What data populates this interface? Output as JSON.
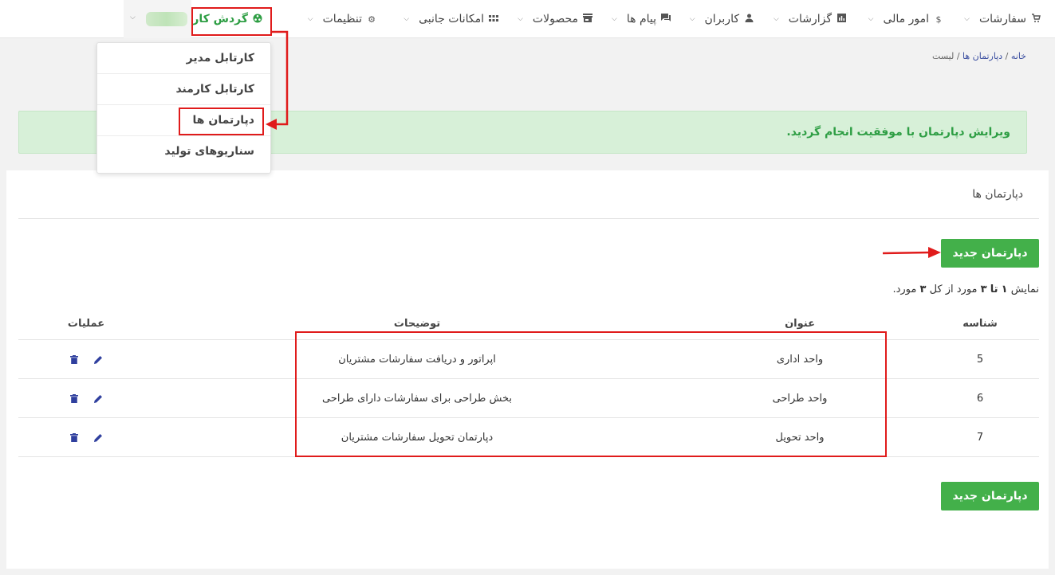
{
  "nav": {
    "items": [
      {
        "label": "سفارشات",
        "icon": "cart-icon"
      },
      {
        "label": "امور مالی",
        "icon": "dollar-icon"
      },
      {
        "label": "گزارشات",
        "icon": "chart-icon"
      },
      {
        "label": "کاربران",
        "icon": "user-icon"
      },
      {
        "label": "پیام ها",
        "icon": "message-icon"
      },
      {
        "label": "محصولات",
        "icon": "store-icon"
      },
      {
        "label": "امکانات جانبی",
        "icon": "grid-icon"
      },
      {
        "label": "تنظیمات",
        "icon": "gear-icon"
      },
      {
        "label": "گردش کار",
        "icon": "workflow-icon"
      }
    ],
    "active_color": "#2e9e44"
  },
  "dropdown": {
    "items": [
      {
        "label": "کارتابل مدیر"
      },
      {
        "label": "کارتابل کارمند"
      },
      {
        "label": "دپارتمان ها"
      },
      {
        "label": "سناریوهای تولید"
      }
    ]
  },
  "breadcrumb": {
    "home": "خانه",
    "sep": "/",
    "section": "دپارتمان ها",
    "current": "لیست"
  },
  "alert": {
    "message": "ویرایش دپارتمان با موفقیت انجام گردید."
  },
  "card": {
    "title": "دپارتمان ها",
    "new_button": "دپارتمان جدید",
    "summary": {
      "prefix": "نمایش",
      "from": "۱",
      "to_word": "تا",
      "to": "۳",
      "middle": "مورد از کل",
      "total": "۳",
      "suffix": "مورد."
    }
  },
  "table": {
    "headers": {
      "id": "شناسه",
      "title": "عنوان",
      "description": "توضیحات",
      "operations": "عملیات"
    },
    "rows": [
      {
        "id": "5",
        "title": "واحد اداری",
        "description": "اپراتور و دریافت سفارشات مشتریان"
      },
      {
        "id": "6",
        "title": "واحد طراحی",
        "description": "بخش طراحی برای سفارشات دارای طراحی"
      },
      {
        "id": "7",
        "title": "واحد تحویل",
        "description": "دپارتمان تحویل سفارشات مشتریان"
      }
    ]
  },
  "colors": {
    "accent_green": "#43b04a",
    "alert_bg": "#d7f0d8",
    "annotation_red": "#e01b1b",
    "icon_blue": "#2f3f9e"
  }
}
